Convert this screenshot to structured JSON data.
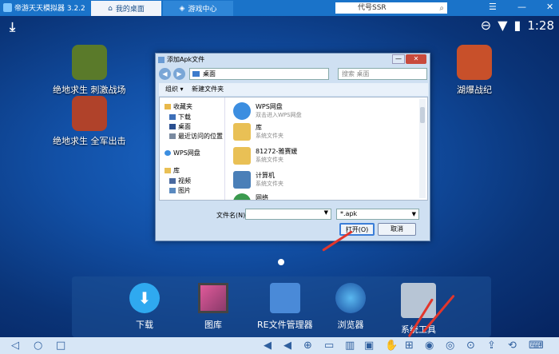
{
  "emulator": {
    "title": "帝游天天模拟器 3.2.2",
    "tabs": [
      {
        "label": "我的桌面"
      },
      {
        "label": "游戏中心"
      }
    ],
    "search_value": "代号SSR",
    "window_controls": [
      "☰",
      "—",
      "✕"
    ]
  },
  "status": {
    "time": "1:28"
  },
  "desktop_apps": [
    {
      "label": "绝地求生 刺激战场",
      "color": "#5a7a2a"
    },
    {
      "label": "绝地求生 全军出击",
      "color": "#b0422a"
    },
    {
      "label": "湖爆战纪",
      "color": "#c8502a"
    }
  ],
  "dock": [
    {
      "label": "下载",
      "color": "#2fa9f0"
    },
    {
      "label": "图库",
      "color": "#8a3a6a"
    },
    {
      "label": "RE文件管理器",
      "color": "#4a8ad8"
    },
    {
      "label": "浏览器",
      "color": "#2a7ac8"
    },
    {
      "label": "系统工具",
      "color": "#b7c5d5"
    }
  ],
  "dialog": {
    "title": "添加Apk文件",
    "address": "桌面",
    "search_placeholder": "搜索 桌面",
    "toolbar": {
      "organize": "组织 ▾",
      "new_folder": "新建文件夹"
    },
    "nav": [
      "收藏夹",
      "下载",
      "桌面",
      "最近访问的位置",
      "WPS网盘",
      "库",
      "视频",
      "图片"
    ],
    "files": [
      {
        "name": "WPS网盘",
        "sub": "双击进入WPS网盘",
        "color": "#3c8ee0"
      },
      {
        "name": "库",
        "sub": "系统文件夹",
        "color": "#e9c055"
      },
      {
        "name": "81272-雅赛媛",
        "sub": "系统文件夹",
        "color": "#e9c055"
      },
      {
        "name": "计算机",
        "sub": "系统文件夹",
        "color": "#4a7fb8"
      },
      {
        "name": "网络",
        "sub": "",
        "color": "#3b9a4e"
      }
    ],
    "filename_label": "文件名(N):",
    "filetype": "*.apk",
    "open_btn": "打开(O)",
    "cancel_btn": "取消"
  }
}
